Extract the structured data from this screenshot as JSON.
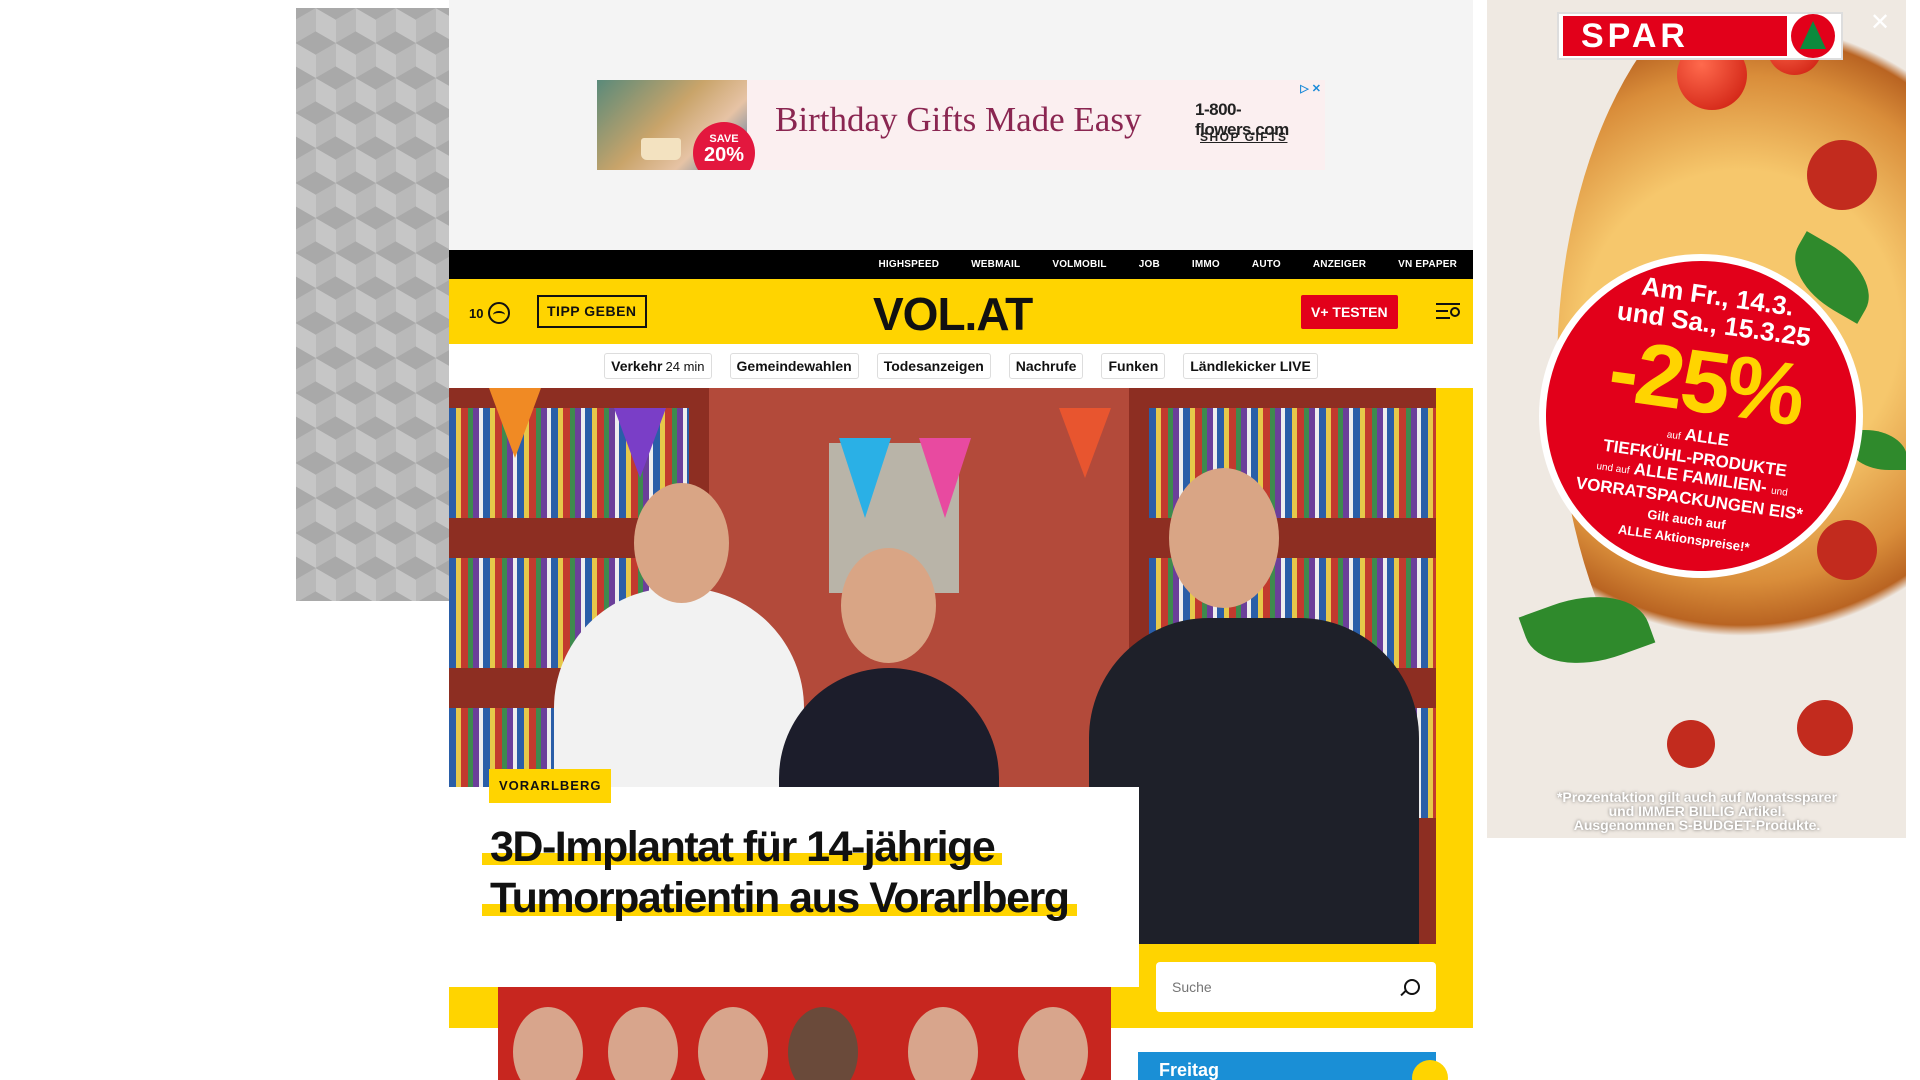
{
  "top_banner_ad": {
    "headline": "Birthday Gifts Made Easy",
    "badge_top": "SAVE",
    "badge_value": "20%",
    "advertiser": "1-800-flowers.com",
    "cta": "SHOP GIFTS",
    "adchoice": "▷ ✕"
  },
  "top_nav": {
    "items": [
      "HIGHSPEED",
      "WEBMAIL",
      "VOLMOBIL",
      "JOB",
      "IMMO",
      "AUTO",
      "ANZEIGER",
      "VN EPAPER"
    ]
  },
  "header": {
    "temperature": "10",
    "tip_button": "TIPP GEBEN",
    "logo": "VOL.AT",
    "subscribe_button": "V+ TESTEN"
  },
  "quick_links": [
    {
      "label": "Verkehr",
      "sub": "24 min"
    },
    {
      "label": "Gemeindewahlen",
      "sub": ""
    },
    {
      "label": "Todesanzeigen",
      "sub": ""
    },
    {
      "label": "Nachrufe",
      "sub": ""
    },
    {
      "label": "Funken",
      "sub": ""
    },
    {
      "label": "Ländlekicker LIVE",
      "sub": ""
    }
  ],
  "hero": {
    "kicker": "VORARLBERG",
    "headline_line1": "3D-Implantat für 14-jährige",
    "headline_line2": "Tumorpatientin aus Vorarlberg"
  },
  "search": {
    "placeholder": "Suche"
  },
  "weather_widget": {
    "day": "Freitag"
  },
  "spar_ad": {
    "brand": "SPAR",
    "close": "✕",
    "date_line1": "Am Fr., 14.3.",
    "date_line2": "und Sa., 15.3.25",
    "discount": "-25%",
    "line_small1": "auf",
    "line_a": "ALLE",
    "line_b": "TIEFKÜHL-PRODUKTE",
    "line_small2": "und auf",
    "line_c": "ALLE FAMILIEN-",
    "line_small3": "und",
    "line_d": "VORRATSPACKUNGEN EIS*",
    "line_e": "Gilt auch auf",
    "line_f": "ALLE Aktionspreise!*",
    "disclaimer1": "*Prozentaktion gilt auch auf Monatssparer",
    "disclaimer2": "und IMMER BILLIG Artikel.",
    "disclaimer3": "Ausgenommen S-BUDGET-Produkte."
  }
}
